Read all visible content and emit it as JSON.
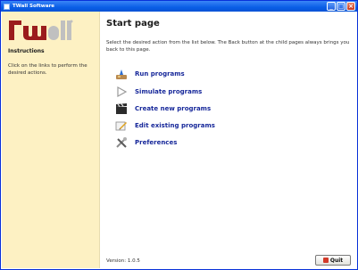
{
  "window": {
    "title": "TWall Software",
    "controls": {
      "minimize": "_",
      "maximize": "□",
      "close": "×"
    }
  },
  "sidebar": {
    "logo_alt": "twall",
    "instructions_title": "Instructions",
    "instructions_text": "Click on the links to perform the desired actions."
  },
  "main": {
    "title": "Start page",
    "description": "Select the desired action from the list below. The Back button at the child pages always brings you back to this page.",
    "actions": [
      {
        "label": "Run programs",
        "icon": "run-programs-icon"
      },
      {
        "label": "Simulate programs",
        "icon": "simulate-play-icon"
      },
      {
        "label": "Create new programs",
        "icon": "clapperboard-icon"
      },
      {
        "label": "Edit existing programs",
        "icon": "edit-pencil-icon"
      },
      {
        "label": "Preferences",
        "icon": "tools-icon"
      }
    ]
  },
  "footer": {
    "version": "Version: 1.0.5",
    "quit_label": "Quit"
  },
  "colors": {
    "titlebar": "#0a5ee6",
    "sidebar_bg": "#fdf1c3",
    "link": "#17289a",
    "logo_red": "#9b1c1c"
  }
}
